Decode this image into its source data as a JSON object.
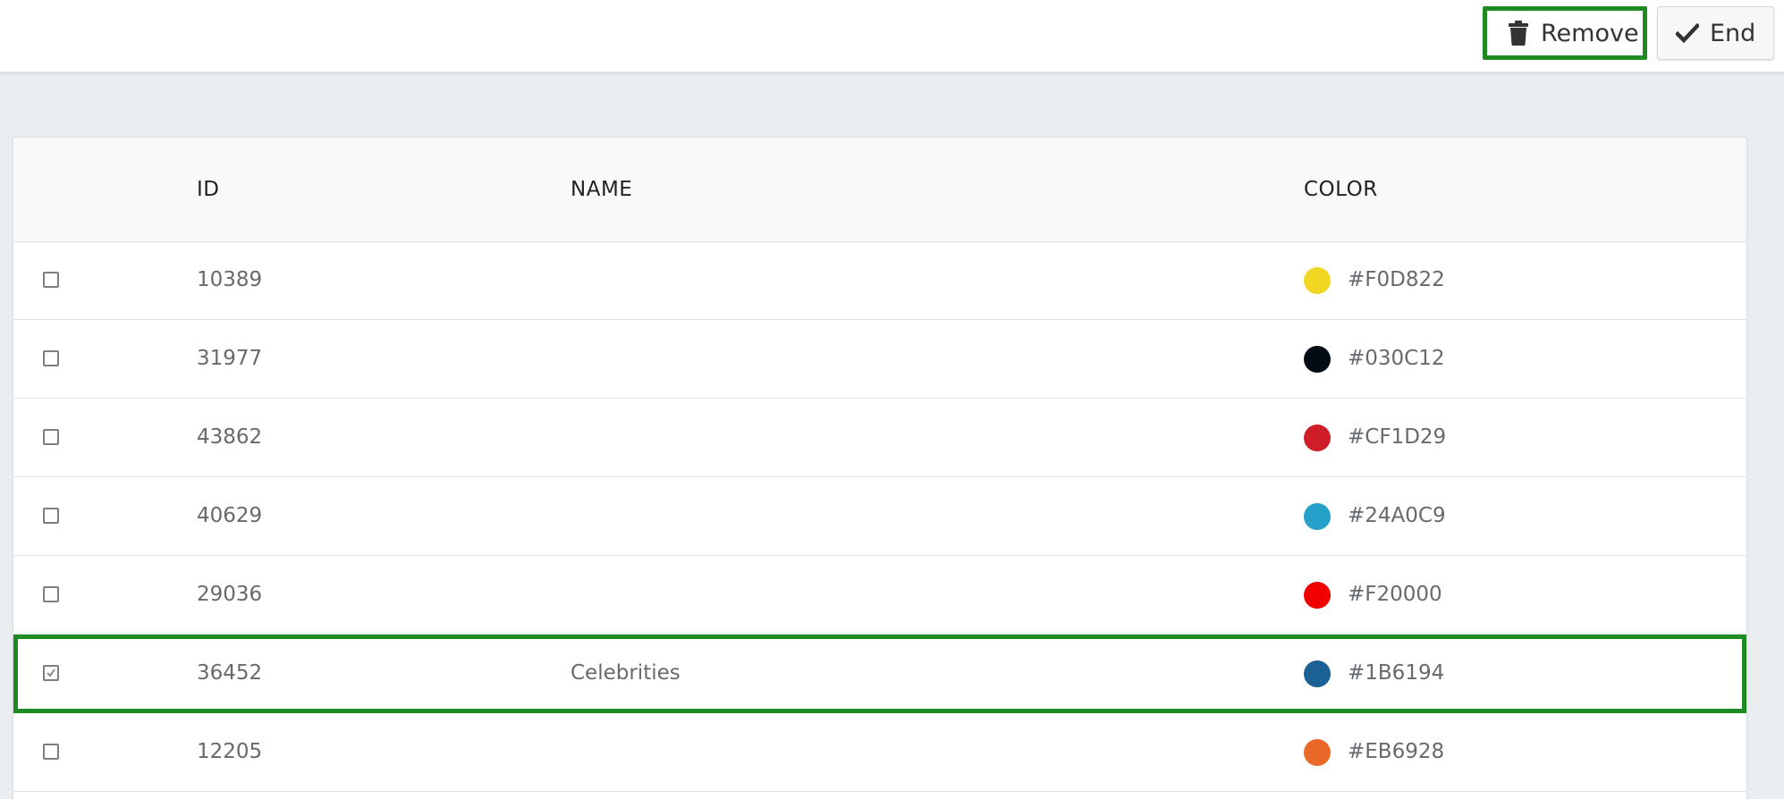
{
  "toolbar": {
    "remove_label": "Remove",
    "remove_icon": "trash-icon",
    "end_label": "End",
    "end_icon": "check-icon"
  },
  "table": {
    "columns": {
      "id": "ID",
      "name": "NAME",
      "color": "COLOR"
    },
    "rows": [
      {
        "id": "10389",
        "name": "",
        "color": "#F0D822",
        "checked": false
      },
      {
        "id": "31977",
        "name": "",
        "color": "#030C12",
        "checked": false
      },
      {
        "id": "43862",
        "name": "",
        "color": "#CF1D29",
        "checked": false
      },
      {
        "id": "40629",
        "name": "",
        "color": "#24A0C9",
        "checked": false
      },
      {
        "id": "29036",
        "name": "",
        "color": "#F20000",
        "checked": false
      },
      {
        "id": "36452",
        "name": "Celebrities",
        "color": "#1B6194",
        "checked": true
      },
      {
        "id": "12205",
        "name": "",
        "color": "#EB6928",
        "checked": false
      }
    ]
  },
  "accent_colors": {
    "highlight": "#1f8a22"
  }
}
